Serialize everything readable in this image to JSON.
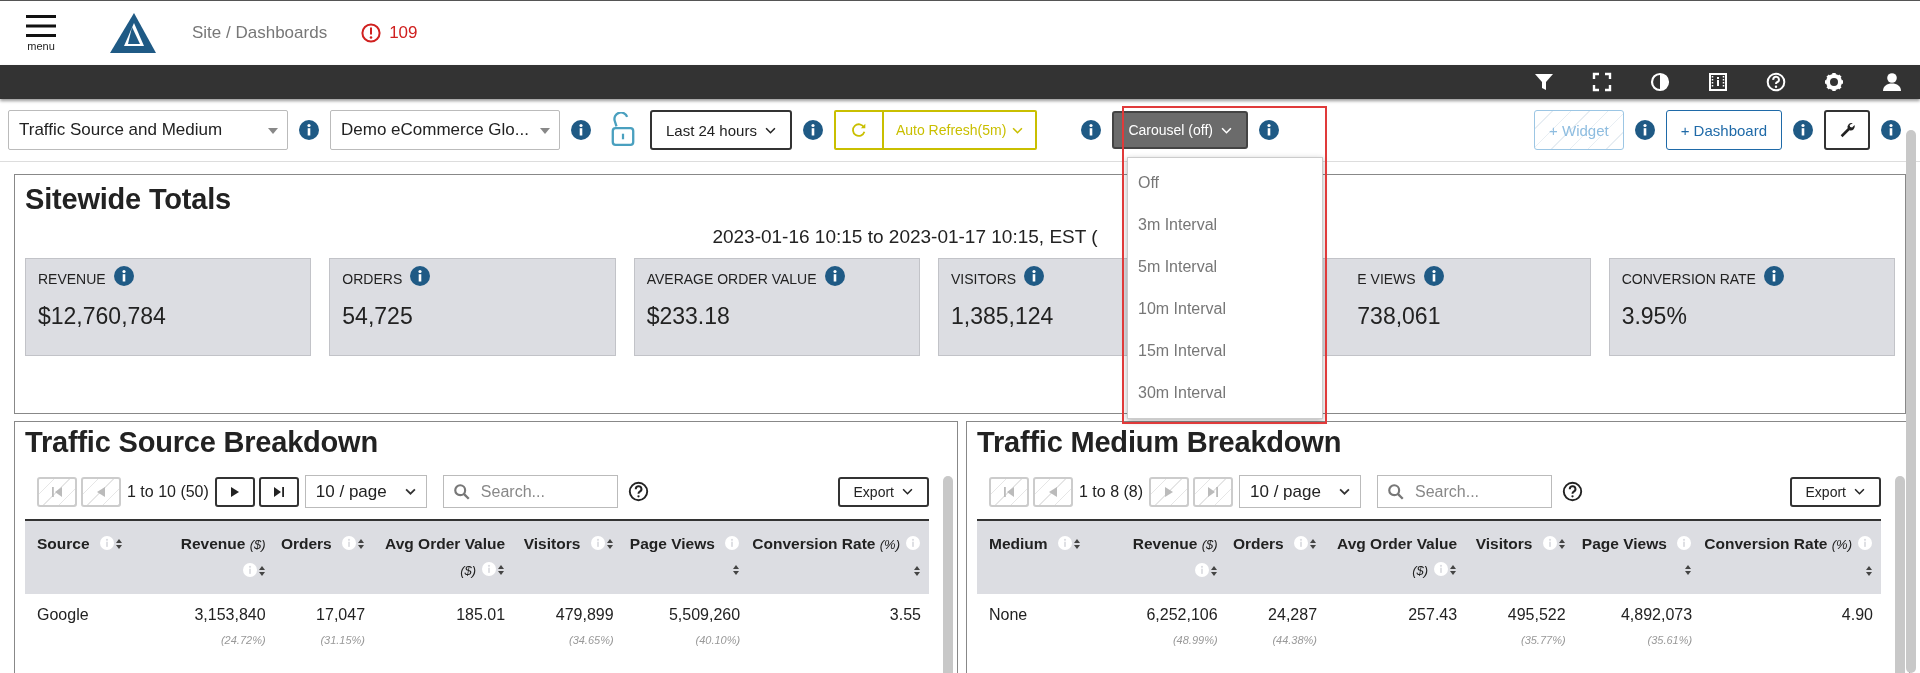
{
  "header": {
    "menu_label": "menu",
    "breadcrumb": "Site / Dashboards",
    "alert_count": "109"
  },
  "toolbar": {
    "dashboard_select": "Traffic Source and Medium",
    "site_select": "Demo eCommerce Glo...",
    "locked": false,
    "time_range": "Last 24 hours",
    "auto_refresh": "Auto Refresh(5m)",
    "carousel": "Carousel (off)",
    "add_widget": {
      "label": "+ Widget",
      "disabled": true
    },
    "add_dashboard": {
      "label": "+ Dashboard",
      "disabled": false
    }
  },
  "carousel_menu": {
    "expanded": true,
    "options": [
      "Off",
      "3m Interval",
      "5m Interval",
      "10m Interval",
      "15m Interval",
      "30m Interval"
    ]
  },
  "sitewide": {
    "title": "Sitewide Totals",
    "range": "2023-01-16 10:15 to 2023-01-17 10:15, EST (",
    "metrics": [
      {
        "label": "REVENUE",
        "value": "$12,760,784",
        "clipped": false
      },
      {
        "label": "ORDERS",
        "value": "54,725",
        "clipped": false
      },
      {
        "label": "AVERAGE ORDER VALUE",
        "value": "$233.18",
        "clipped": false
      },
      {
        "label": "VISITORS",
        "value": "1,385,124",
        "clipped": false
      },
      {
        "label": "E VIEWS",
        "value": "738,061",
        "clipped": true
      },
      {
        "label": "CONVERSION RATE",
        "value": "3.95%",
        "clipped": false
      }
    ]
  },
  "tables": [
    {
      "title": "Traffic Source Breakdown",
      "range": "1 to 10 (50)",
      "can_go_back": false,
      "can_go_forward": true,
      "page_size": "10 / page",
      "search_placeholder": "Search...",
      "export": "Export",
      "columns": [
        {
          "label": "Source"
        },
        {
          "label": "Revenue",
          "unit": "($)"
        },
        {
          "label": "Orders"
        },
        {
          "label": "Avg Order Value",
          "unit": "($)"
        },
        {
          "label": "Visitors"
        },
        {
          "label": "Page Views"
        },
        {
          "label": "Conversion Rate",
          "unit": "(%)"
        }
      ],
      "rows": [
        {
          "cells": [
            {
              "value": "Google"
            },
            {
              "value": "3,153,840",
              "share": "(24.72%)"
            },
            {
              "value": "17,047",
              "share": "(31.15%)"
            },
            {
              "value": "185.01"
            },
            {
              "value": "479,899",
              "share": "(34.65%)"
            },
            {
              "value": "5,509,260",
              "share": "(40.10%)"
            },
            {
              "value": "3.55"
            }
          ]
        }
      ]
    },
    {
      "title": "Traffic Medium Breakdown",
      "range": "1 to 8 (8)",
      "can_go_back": false,
      "can_go_forward": false,
      "page_size": "10 / page",
      "search_placeholder": "Search...",
      "export": "Export",
      "columns": [
        {
          "label": "Medium"
        },
        {
          "label": "Revenue",
          "unit": "($)"
        },
        {
          "label": "Orders"
        },
        {
          "label": "Avg Order Value",
          "unit": "($)"
        },
        {
          "label": "Visitors"
        },
        {
          "label": "Page Views"
        },
        {
          "label": "Conversion Rate",
          "unit": "(%)"
        }
      ],
      "rows": [
        {
          "cells": [
            {
              "value": "None"
            },
            {
              "value": "6,252,106",
              "share": "(48.99%)"
            },
            {
              "value": "24,287",
              "share": "(44.38%)"
            },
            {
              "value": "257.43"
            },
            {
              "value": "495,522",
              "share": "(35.77%)"
            },
            {
              "value": "4,892,073",
              "share": "(35.61%)"
            },
            {
              "value": "4.90"
            }
          ]
        }
      ]
    }
  ]
}
